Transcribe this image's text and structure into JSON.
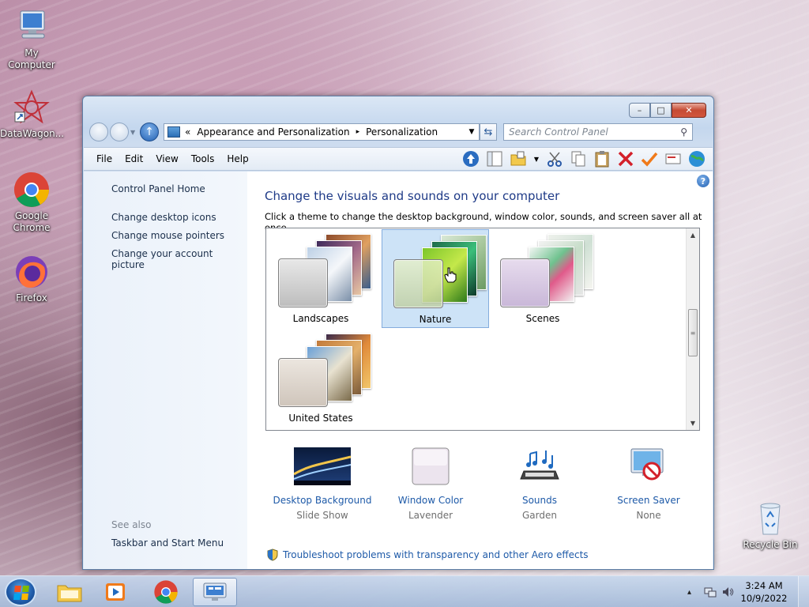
{
  "desktop": {
    "icons": [
      {
        "label": "My Computer",
        "icon": "computer-icon"
      },
      {
        "label": "DataWagon...",
        "icon": "datawagon-icon"
      },
      {
        "label": "Google Chrome",
        "icon": "chrome-icon"
      },
      {
        "label": "Firefox",
        "icon": "firefox-icon"
      },
      {
        "label": "Recycle Bin",
        "icon": "recycle-bin-icon"
      }
    ]
  },
  "window": {
    "controls": {
      "minimize": "–",
      "maximize": "□",
      "close": "✕"
    },
    "address": {
      "prefix": "«",
      "crumb1": "Appearance and Personalization",
      "separator": "▸",
      "crumb2": "Personalization"
    },
    "search": {
      "placeholder": "Search Control Panel"
    },
    "menu": [
      "File",
      "Edit",
      "View",
      "Tools",
      "Help"
    ],
    "sidebar": {
      "home": "Control Panel Home",
      "links": [
        "Change desktop icons",
        "Change mouse pointers",
        "Change your account picture"
      ],
      "see_also": "See also",
      "see_also_links": [
        "Taskbar and Start Menu"
      ]
    },
    "main": {
      "title": "Change the visuals and sounds on your computer",
      "subtitle": "Click a theme to change the desktop background, window color, sounds, and screen saver all at once.",
      "themes": [
        {
          "name": "Landscapes",
          "selected": false
        },
        {
          "name": "Nature",
          "selected": true
        },
        {
          "name": "Scenes",
          "selected": false
        },
        {
          "name": "United States",
          "selected": false
        }
      ],
      "settings": [
        {
          "label": "Desktop Background",
          "value": "Slide Show"
        },
        {
          "label": "Window Color",
          "value": "Lavender"
        },
        {
          "label": "Sounds",
          "value": "Garden"
        },
        {
          "label": "Screen Saver",
          "value": "None"
        }
      ],
      "troubleshoot": "Troubleshoot problems with transparency and other Aero effects"
    }
  },
  "taskbar": {
    "clock_time": "3:24 AM",
    "clock_date": "10/9/2022",
    "tray_arrow": "▴",
    "accent": "#1e5aa8"
  }
}
